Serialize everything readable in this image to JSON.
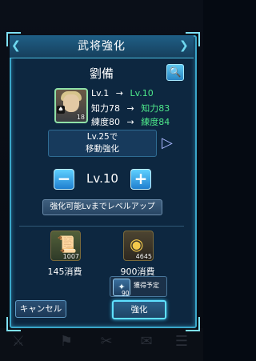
{
  "dialog": {
    "title": "武将強化"
  },
  "general": {
    "name": "劉備",
    "portrait_badge": "♠",
    "portrait_number": "18"
  },
  "stats": {
    "level": {
      "label": "Lv.",
      "from": "Lv.1",
      "to": "Lv.10"
    },
    "intelligence": {
      "from": "知力78",
      "to": "知力83"
    },
    "training": {
      "from": "練度80",
      "to": "練度84"
    },
    "arrow": "→"
  },
  "evolution_info": {
    "line1": "Lv.25で",
    "line2": "移動強化"
  },
  "level_selector": {
    "value": "Lv.10",
    "minus": "−",
    "plus": "+"
  },
  "levelup_button": "強化可能Lvまでレベルアップ",
  "costs": [
    {
      "icon": "scroll-icon",
      "glyph": "📜",
      "count": "1007",
      "label": "145消費"
    },
    {
      "icon": "coin-icon",
      "glyph": "◉",
      "count": "4645",
      "label": "900消費"
    }
  ],
  "gain": {
    "label": "獲得予定",
    "count": "90",
    "glyph": "✦"
  },
  "buttons": {
    "cancel": "キャンセル",
    "confirm": "強化"
  },
  "colors": {
    "accent": "#3aa6c9",
    "highlight": "#4ee88a",
    "panel": "#0d2740"
  }
}
